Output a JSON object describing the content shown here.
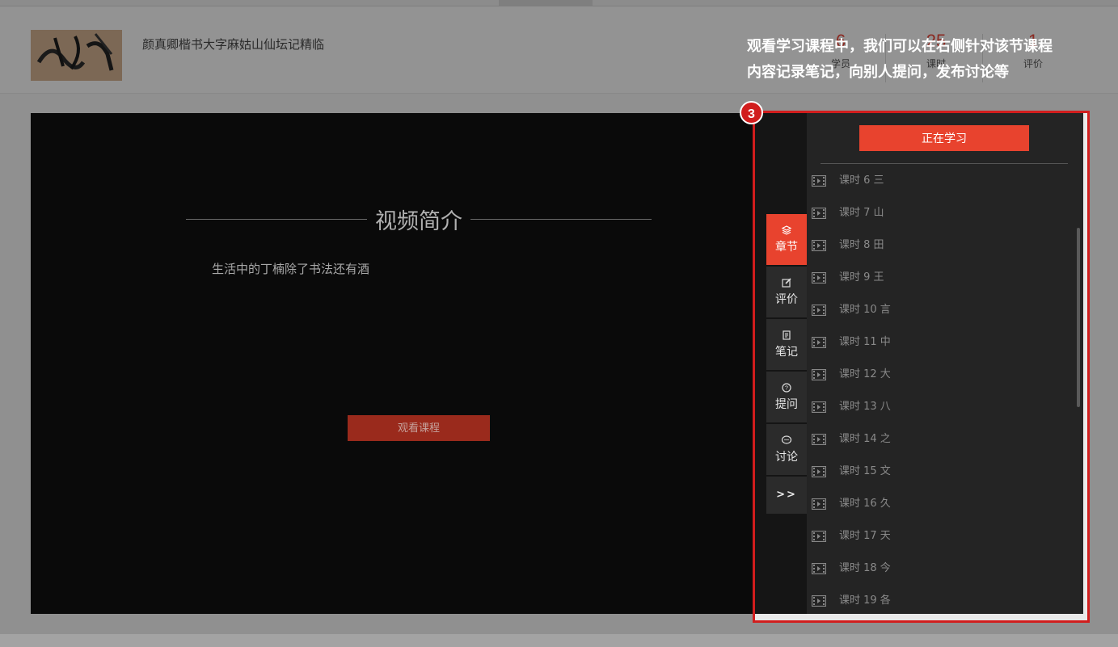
{
  "header": {
    "course_title": "颜真卿楷书大字麻姑山仙坛记精临",
    "stats": [
      {
        "num": "6",
        "label": "学员"
      },
      {
        "num": "25",
        "label": "课时"
      },
      {
        "num": "1",
        "label": "评价"
      }
    ]
  },
  "annotation": {
    "line1": "观看学习课程中，我们可以在右侧针对该节课程",
    "line2": "内容记录笔记，向别人提问，发布讨论等",
    "badge": "3"
  },
  "video": {
    "intro_title": "视频简介",
    "intro_desc": "生活中的丁楠除了书法还有酒",
    "watch_button": "观看课程"
  },
  "sidebar": {
    "tabs": [
      {
        "label": "章节",
        "icon": "layers-icon",
        "active": true
      },
      {
        "label": "评价",
        "icon": "edit-icon",
        "active": false
      },
      {
        "label": "笔记",
        "icon": "note-icon",
        "active": false
      },
      {
        "label": "提问",
        "icon": "question-icon",
        "active": false
      },
      {
        "label": "讨论",
        "icon": "chat-icon",
        "active": false
      }
    ],
    "more_label": ">>",
    "studying_button": "正在学习",
    "lessons": [
      {
        "label": "课时 6 三"
      },
      {
        "label": "课时 7 山"
      },
      {
        "label": "课时 8 田"
      },
      {
        "label": "课时 9 王"
      },
      {
        "label": "课时 10 言"
      },
      {
        "label": "课时 11 中"
      },
      {
        "label": "课时 12 大"
      },
      {
        "label": "课时 13 八"
      },
      {
        "label": "课时 14 之"
      },
      {
        "label": "课时 15 文"
      },
      {
        "label": "课时 16 久"
      },
      {
        "label": "课时 17 天"
      },
      {
        "label": "课时 18 今"
      },
      {
        "label": "课时 19 各"
      }
    ]
  },
  "colors": {
    "accent": "#e8432e",
    "highlight_outline": "#d11d1d",
    "video_bg": "#0a0a0a"
  }
}
